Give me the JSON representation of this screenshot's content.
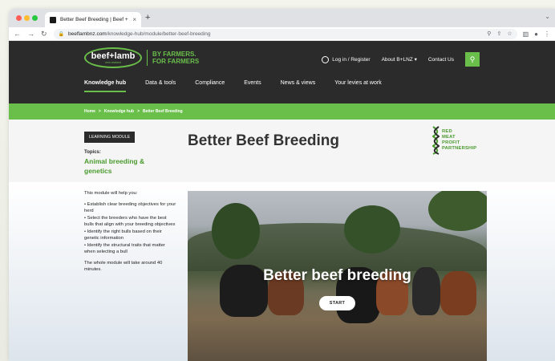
{
  "browser": {
    "tab_title": "Better Beef Breeding | Beef + L",
    "tab_close": "×",
    "new_tab": "+",
    "tab_menu": "⌄",
    "url_host": "beeflambnz.com",
    "url_path": "/knowledge-hub/module/better-beef-breeding"
  },
  "header": {
    "logo_text": "beef+lamb",
    "logo_sub": "new zealand",
    "tagline_line1": "BY FARMERS.",
    "tagline_line2": "FOR FARMERS",
    "login": "Log in / Register",
    "about": "About B+LNZ",
    "contact": "Contact Us"
  },
  "nav": {
    "items": [
      "Knowledge hub",
      "Data & tools",
      "Compliance",
      "Events",
      "News & views",
      "Your levies at work"
    ]
  },
  "breadcrumb": {
    "home": "Home",
    "knowledge_hub": "Knowledge hub",
    "current": "Better Beef Breeding",
    "separator": ">"
  },
  "intro": {
    "module_tag": "LEARNING MODULE",
    "topics_label": "Topics:",
    "topics_value": "Animal breeding & genetics",
    "title": "Better Beef Breeding",
    "partner_lines": [
      "RED",
      "MEAT",
      "PROFIT",
      "PARTNERSHIP"
    ]
  },
  "module": {
    "intro_text": "This module will help you:",
    "bullets": [
      "• Establish clear breeding objectives for your herd",
      "• Select the breeders who have the best bulls that align with your breeding objectives",
      "• Identify the right bulls based on their genetic information",
      "• Identify the structural traits that matter when selecting a bull"
    ],
    "duration": "The whole module will take around 40 minutes."
  },
  "video": {
    "title": "Better beef breeding",
    "start_label": "START"
  },
  "colors": {
    "brand_green": "#6abf4b",
    "header_dark": "#2b2b2b",
    "topic_green": "#4a9a2e"
  }
}
